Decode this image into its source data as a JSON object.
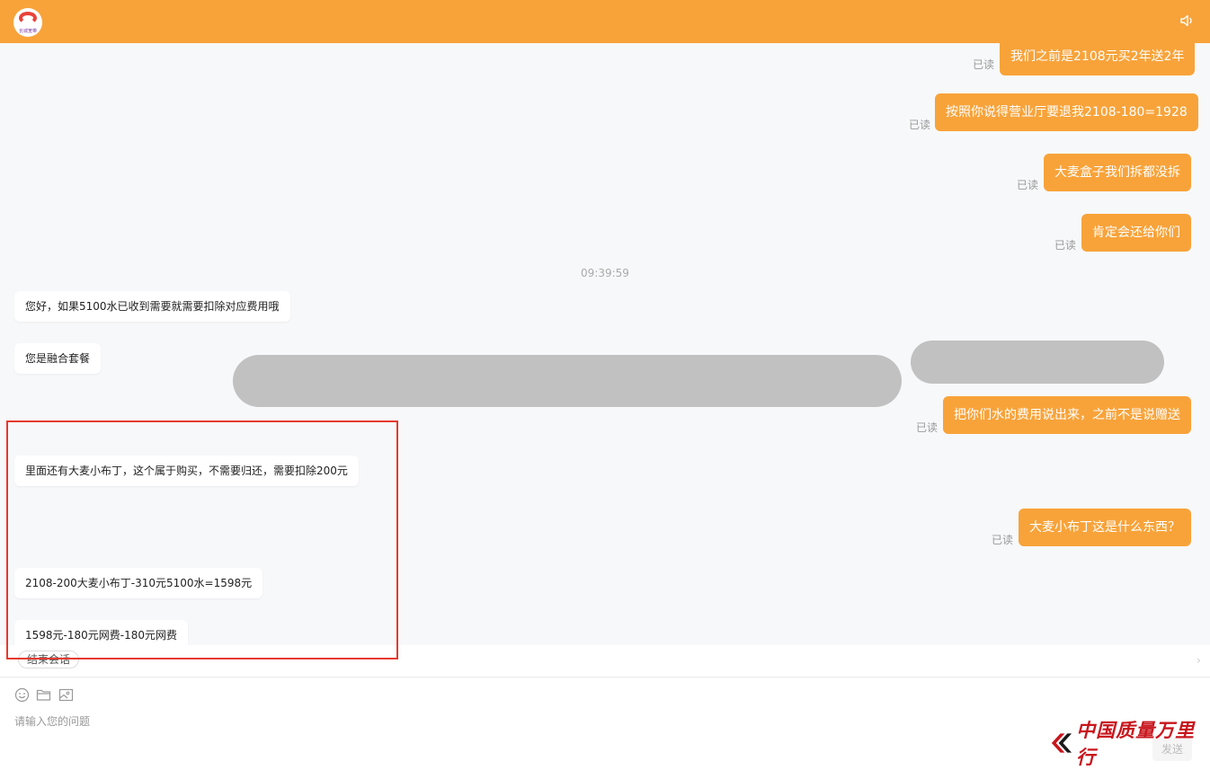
{
  "header": {
    "logo_text": "长城宽带",
    "brand_color": "#f8a33a",
    "speaker_icon": "speaker-icon"
  },
  "read_label": "已读",
  "messages_right": [
    {
      "text": "我们之前是2108元买2年送2年"
    },
    {
      "text": "按照你说得营业厅要退我2108-180=1928"
    },
    {
      "text": "大麦盒子我们拆都没拆"
    },
    {
      "text": "肯定会还给你们"
    },
    {
      "text": "把你们水的费用说出来，之前不是说赠送"
    },
    {
      "text": "大麦小布丁这是什么东西？"
    }
  ],
  "timestamp": "09:39:59",
  "messages_left": [
    {
      "text": "您好，如果5100水已收到需要就需要扣除对应费用哦"
    },
    {
      "text": "您是融合套餐"
    },
    {
      "text": "里面还有大麦小布丁，这个属于购买，不需要归还，需要扣除200元"
    },
    {
      "text": "2108-200大麦小布丁-310元5100水=1598元"
    },
    {
      "text": "1598元-180元网费-180元网费"
    }
  ],
  "quickbar": {
    "end_session": "结束会话",
    "arrow": "›"
  },
  "input": {
    "placeholder": "请输入您的问题",
    "send_label": "发送",
    "tools": [
      "emoji-icon",
      "folder-icon",
      "image-icon"
    ]
  },
  "watermark": {
    "text": "中国质量万里行"
  },
  "highlight_color": "#e63a2e"
}
